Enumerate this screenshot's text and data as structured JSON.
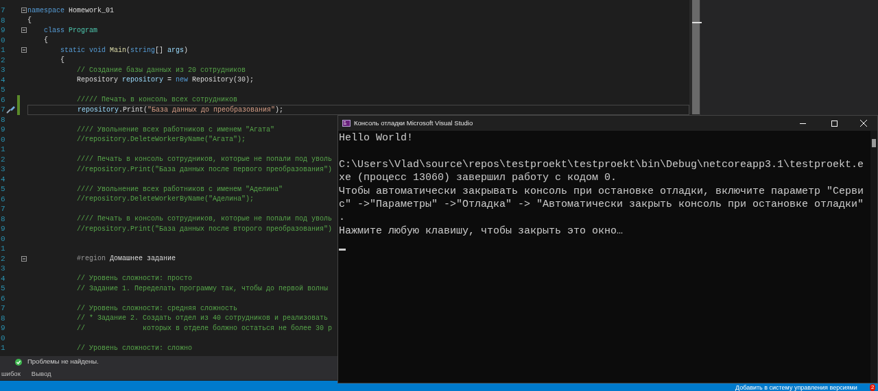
{
  "editor": {
    "lines": [
      {
        "num": "7",
        "fold": true,
        "changed": false,
        "current": false,
        "tokens": [
          {
            "kind": "keyword",
            "text": "namespace"
          },
          {
            "kind": "plain",
            "text": " Homework_01"
          }
        ]
      },
      {
        "num": "8",
        "fold": false,
        "changed": false,
        "current": false,
        "tokens": [
          {
            "kind": "plain",
            "text": "{"
          }
        ]
      },
      {
        "num": "9",
        "fold": true,
        "changed": false,
        "current": false,
        "tokens": [
          {
            "kind": "keyword",
            "text": "    class"
          },
          {
            "kind": "type",
            "text": " Program"
          }
        ]
      },
      {
        "num": "0",
        "fold": false,
        "changed": false,
        "current": false,
        "tokens": [
          {
            "kind": "plain",
            "text": "    {"
          }
        ]
      },
      {
        "num": "1",
        "fold": true,
        "changed": false,
        "current": false,
        "tokens": [
          {
            "kind": "keyword",
            "text": "        static void"
          },
          {
            "kind": "method",
            "text": " Main"
          },
          {
            "kind": "plain",
            "text": "("
          },
          {
            "kind": "keyword",
            "text": "string"
          },
          {
            "kind": "plain",
            "text": "[] "
          },
          {
            "kind": "variable",
            "text": "args"
          },
          {
            "kind": "plain",
            "text": ")"
          }
        ]
      },
      {
        "num": "2",
        "fold": false,
        "changed": false,
        "current": false,
        "tokens": [
          {
            "kind": "plain",
            "text": "        {"
          }
        ]
      },
      {
        "num": "3",
        "fold": false,
        "changed": false,
        "current": false,
        "tokens": [
          {
            "kind": "comment",
            "text": "            // Создание базы данных из 20 сотрудников"
          }
        ]
      },
      {
        "num": "4",
        "fold": false,
        "changed": false,
        "current": false,
        "tokens": [
          {
            "kind": "plain",
            "text": "            Repository "
          },
          {
            "kind": "variable",
            "text": "repository"
          },
          {
            "kind": "plain",
            "text": " = "
          },
          {
            "kind": "keyword",
            "text": "new"
          },
          {
            "kind": "plain",
            "text": " Repository(30);"
          }
        ]
      },
      {
        "num": "5",
        "fold": false,
        "changed": false,
        "current": false
      },
      {
        "num": "6",
        "fold": false,
        "changed": true,
        "current": false,
        "tokens": [
          {
            "kind": "comment",
            "text": "            ///// Печать в консоль всех сотрудников"
          }
        ]
      },
      {
        "num": "7",
        "fold": false,
        "changed": true,
        "current": true,
        "tokens": [
          {
            "kind": "variable",
            "text": "            repository"
          },
          {
            "kind": "plain",
            "text": ".Print("
          },
          {
            "kind": "string",
            "text": "\"База данных до преобразования\""
          },
          {
            "kind": "plain",
            "text": ");"
          }
        ]
      },
      {
        "num": "8",
        "fold": false,
        "changed": false,
        "current": false
      },
      {
        "num": "9",
        "fold": false,
        "changed": false,
        "current": false,
        "tokens": [
          {
            "kind": "comment",
            "text": "            //// Увольнение всех работников с именем \"Агата\""
          }
        ]
      },
      {
        "num": "0",
        "fold": false,
        "changed": false,
        "current": false,
        "tokens": [
          {
            "kind": "comment",
            "text": "            //repository.DeleteWorkerByName(\"Агата\");"
          }
        ]
      },
      {
        "num": "1",
        "fold": false,
        "changed": false,
        "current": false
      },
      {
        "num": "2",
        "fold": false,
        "changed": false,
        "current": false,
        "tokens": [
          {
            "kind": "comment",
            "text": "            //// Печать в консоль сотрудников, которые не попали под уволь"
          }
        ]
      },
      {
        "num": "3",
        "fold": false,
        "changed": false,
        "current": false,
        "tokens": [
          {
            "kind": "comment",
            "text": "            //repository.Print(\"База данных после первого преобразования\")"
          }
        ]
      },
      {
        "num": "4",
        "fold": false,
        "changed": false,
        "current": false
      },
      {
        "num": "5",
        "fold": false,
        "changed": false,
        "current": false,
        "tokens": [
          {
            "kind": "comment",
            "text": "            //// Увольнение всех работников с именем \"Аделина\""
          }
        ]
      },
      {
        "num": "6",
        "fold": false,
        "changed": false,
        "current": false,
        "tokens": [
          {
            "kind": "comment",
            "text": "            //repository.DeleteWorkerByName(\"Аделина\");"
          }
        ]
      },
      {
        "num": "7",
        "fold": false,
        "changed": false,
        "current": false
      },
      {
        "num": "8",
        "fold": false,
        "changed": false,
        "current": false,
        "tokens": [
          {
            "kind": "comment",
            "text": "            //// Печать в консоль сотрудников, которые не попали под уволь"
          }
        ]
      },
      {
        "num": "9",
        "fold": false,
        "changed": false,
        "current": false,
        "tokens": [
          {
            "kind": "comment",
            "text": "            //repository.Print(\"База данных после второго преобразования\")"
          }
        ]
      },
      {
        "num": "0",
        "fold": false,
        "changed": false,
        "current": false
      },
      {
        "num": "1",
        "fold": false,
        "changed": false,
        "current": false
      },
      {
        "num": "2",
        "fold": true,
        "changed": false,
        "current": false,
        "tokens": [
          {
            "kind": "preprocessor",
            "text": "            #region"
          },
          {
            "kind": "plain",
            "text": " Домашнее задание"
          }
        ]
      },
      {
        "num": "3",
        "fold": false,
        "changed": false,
        "current": false
      },
      {
        "num": "4",
        "fold": false,
        "changed": false,
        "current": false,
        "tokens": [
          {
            "kind": "comment",
            "text": "            // Уровень сложности: просто"
          }
        ]
      },
      {
        "num": "5",
        "fold": false,
        "changed": false,
        "current": false,
        "tokens": [
          {
            "kind": "comment",
            "text": "            // Задание 1. Переделать программу так, чтобы до первой волны"
          }
        ]
      },
      {
        "num": "6",
        "fold": false,
        "changed": false,
        "current": false
      },
      {
        "num": "7",
        "fold": false,
        "changed": false,
        "current": false,
        "tokens": [
          {
            "kind": "comment",
            "text": "            // Уровень сложности: средняя сложность"
          }
        ]
      },
      {
        "num": "8",
        "fold": false,
        "changed": false,
        "current": false,
        "tokens": [
          {
            "kind": "comment",
            "text": "            // * Задание 2. Создать отдел из 40 сотрудников и реализовать"
          }
        ]
      },
      {
        "num": "9",
        "fold": false,
        "changed": false,
        "current": false,
        "tokens": [
          {
            "kind": "comment",
            "text": "            //              которых в отделе болжно остаться не более 30 р"
          }
        ]
      },
      {
        "num": "0",
        "fold": false,
        "changed": false,
        "current": false
      },
      {
        "num": "1",
        "fold": false,
        "changed": false,
        "current": false,
        "tokens": [
          {
            "kind": "comment",
            "text": "            // Уровень сложности: сложно"
          }
        ]
      }
    ]
  },
  "error_bar": {
    "status": "Проблемы не найдены."
  },
  "bottom_tabs": [
    {
      "label": "шибок",
      "selected": false
    },
    {
      "label": "Вывод",
      "selected": false
    }
  ],
  "status_bar": {
    "source_control": "Добавить в систему управления версиями",
    "badge": "2"
  },
  "console": {
    "title": "Консоль отладки Microsoft Visual Studio",
    "blocks": [
      {
        "lines": [
          "Hello World!"
        ]
      },
      {
        "lines": [
          "C:\\Users\\Vlad\\source\\repos\\testproekt\\testproekt\\bin\\Debug\\netcoreapp3.1\\testproekt.e",
          "xe (процесс 13060) завершил работу с кодом 0.",
          "Чтобы автоматически закрывать консоль при остановке отладки, включите параметр \"Серви",
          "с\" ->\"Параметры\" ->\"Отладка\" -> \"Автоматически закрыть консоль при остановке отладки\"",
          ".",
          "Нажмите любую клавишу, чтобы закрыть это окно…"
        ]
      }
    ]
  }
}
